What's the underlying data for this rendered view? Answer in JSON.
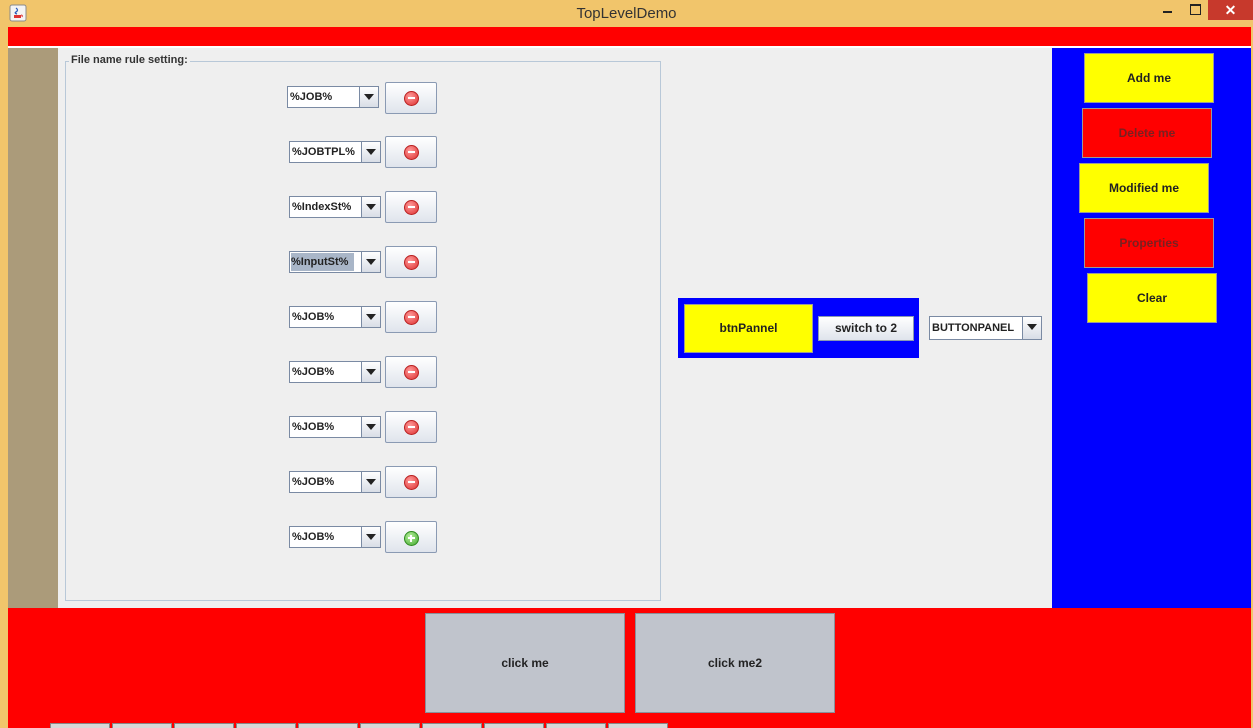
{
  "window": {
    "title": "TopLevelDemo",
    "close_glyph": "✕",
    "colors": {
      "titlebar": "#f1c56b",
      "close": "#c7392c"
    }
  },
  "layout_colors": {
    "north": "#ff0000",
    "west": "#ab9b7a",
    "center": "#efefef",
    "east": "#0000ff",
    "south": "#ff0000"
  },
  "rule_group": {
    "title": "File name rule setting:",
    "rows": [
      {
        "combo": "%JOB%",
        "action": "remove",
        "icon": "minus-circle-icon"
      },
      {
        "combo": "%JOBTPL%",
        "action": "remove",
        "icon": "minus-circle-icon"
      },
      {
        "combo": "%IndexSt%",
        "action": "remove",
        "icon": "minus-circle-icon"
      },
      {
        "combo": "%InputSt%",
        "action": "remove",
        "icon": "minus-circle-icon",
        "selected": true
      },
      {
        "combo": "%JOB%",
        "action": "remove",
        "icon": "minus-circle-icon"
      },
      {
        "combo": "%JOB%",
        "action": "remove",
        "icon": "minus-circle-icon"
      },
      {
        "combo": "%JOB%",
        "action": "remove",
        "icon": "minus-circle-icon"
      },
      {
        "combo": "%JOB%",
        "action": "remove",
        "icon": "minus-circle-icon"
      },
      {
        "combo": "%JOB%",
        "action": "add",
        "icon": "plus-circle-icon"
      }
    ]
  },
  "card_panel": {
    "btnpannel_label": "btnPannel",
    "switch_label": "switch to 2",
    "selector_value": "BUTTONPANEL"
  },
  "east_buttons": [
    {
      "label": "Add me",
      "color": "#ffff00"
    },
    {
      "label": "Delete me",
      "color": "#ff0000"
    },
    {
      "label": "Modified me",
      "color": "#ffff00"
    },
    {
      "label": "Properties",
      "color": "#ff0000"
    },
    {
      "label": "Clear",
      "color": "#ffff00"
    }
  ],
  "south_buttons": [
    {
      "label": "click me"
    },
    {
      "label": "click me2"
    }
  ]
}
